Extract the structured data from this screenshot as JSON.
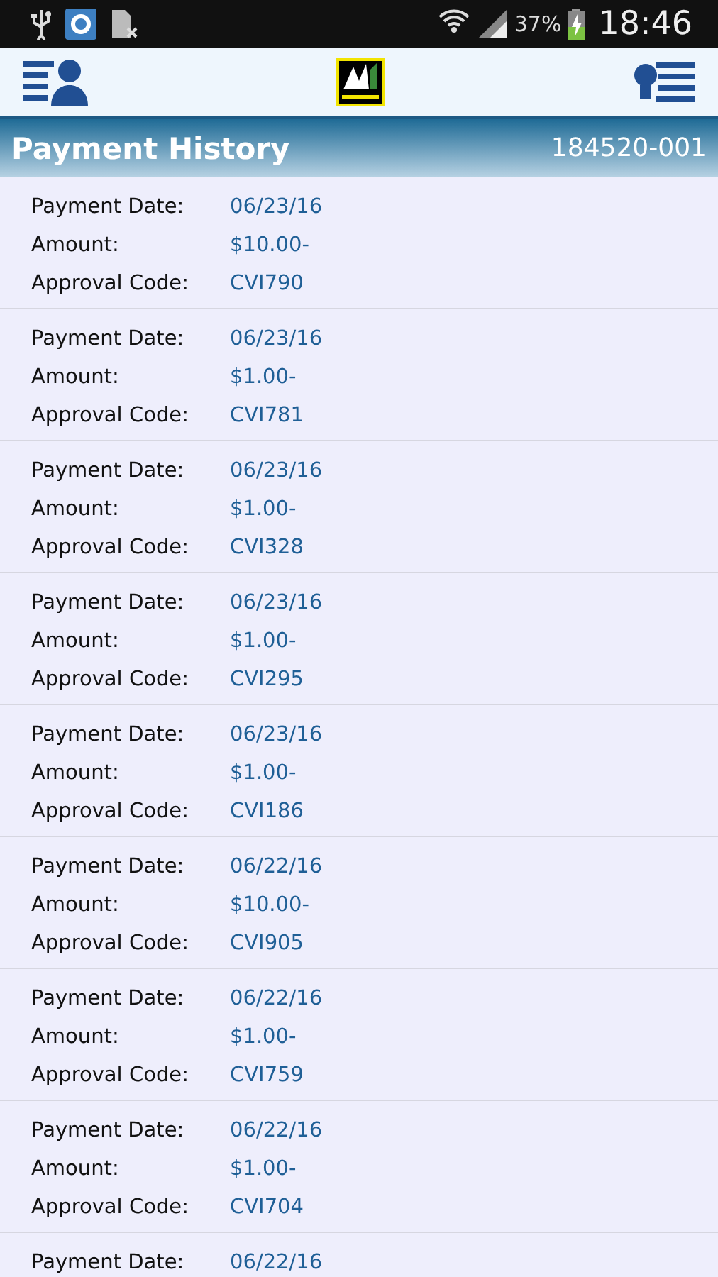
{
  "status_bar": {
    "battery": "37%",
    "time": "18:46"
  },
  "header": {
    "title": "Payment History",
    "account": "184520-001"
  },
  "payments": [
    {
      "fields": [
        {
          "label": "Payment Date:",
          "value": "06/23/16"
        },
        {
          "label": "Amount:",
          "value": "$10.00-"
        },
        {
          "label": "Approval Code:",
          "value": "CVI790"
        }
      ]
    },
    {
      "fields": [
        {
          "label": "Payment Date:",
          "value": "06/23/16"
        },
        {
          "label": "Amount:",
          "value": "$1.00-"
        },
        {
          "label": "Approval Code:",
          "value": "CVI781"
        }
      ]
    },
    {
      "fields": [
        {
          "label": "Payment Date:",
          "value": "06/23/16"
        },
        {
          "label": "Amount:",
          "value": "$1.00-"
        },
        {
          "label": "Approval Code:",
          "value": "CVI328"
        }
      ]
    },
    {
      "fields": [
        {
          "label": "Payment Date:",
          "value": "06/23/16"
        },
        {
          "label": "Amount:",
          "value": "$1.00-"
        },
        {
          "label": "Approval Code:",
          "value": "CVI295"
        }
      ]
    },
    {
      "fields": [
        {
          "label": "Payment Date:",
          "value": "06/23/16"
        },
        {
          "label": "Amount:",
          "value": "$1.00-"
        },
        {
          "label": "Approval Code:",
          "value": "CVI186"
        }
      ]
    },
    {
      "fields": [
        {
          "label": "Payment Date:",
          "value": "06/22/16"
        },
        {
          "label": "Amount:",
          "value": "$10.00-"
        },
        {
          "label": "Approval Code:",
          "value": "CVI905"
        }
      ]
    },
    {
      "fields": [
        {
          "label": "Payment Date:",
          "value": "06/22/16"
        },
        {
          "label": "Amount:",
          "value": "$1.00-"
        },
        {
          "label": "Approval Code:",
          "value": "CVI759"
        }
      ]
    },
    {
      "fields": [
        {
          "label": "Payment Date:",
          "value": "06/22/16"
        },
        {
          "label": "Amount:",
          "value": "$1.00-"
        },
        {
          "label": "Approval Code:",
          "value": "CVI704"
        }
      ]
    },
    {
      "fields": [
        {
          "label": "Payment Date:",
          "value": "06/22/16"
        }
      ]
    }
  ]
}
